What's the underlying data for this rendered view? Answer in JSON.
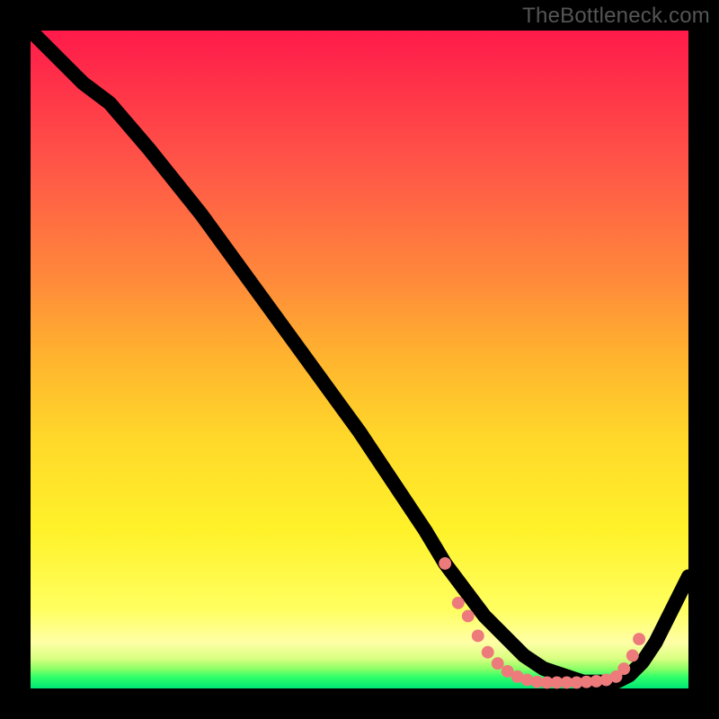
{
  "watermark": "TheBottleneck.com",
  "colors": {
    "curve": "#000000",
    "marker": "#ee7b7b",
    "frame": "#000000"
  },
  "chart_data": {
    "type": "line",
    "title": "",
    "xlabel": "",
    "ylabel": "",
    "xlim": [
      0,
      100
    ],
    "ylim": [
      0,
      100
    ],
    "grid": false,
    "legend": false,
    "series": [
      {
        "name": "bottleneck-curve",
        "x": [
          0,
          4,
          8,
          12,
          18,
          26,
          34,
          42,
          50,
          56,
          60,
          63,
          66,
          69,
          72,
          75,
          78,
          81,
          84,
          87,
          89,
          91,
          93,
          95,
          97,
          100
        ],
        "y": [
          100,
          96,
          92,
          89,
          82,
          72,
          61,
          50,
          39,
          30,
          24,
          19,
          15,
          11,
          8,
          5,
          3,
          2,
          1,
          1,
          1,
          2,
          4,
          7,
          11,
          17
        ]
      }
    ],
    "markers": [
      {
        "x": 63.0,
        "y": 19.0
      },
      {
        "x": 65.0,
        "y": 13.0
      },
      {
        "x": 66.5,
        "y": 11.0
      },
      {
        "x": 68.0,
        "y": 8.0
      },
      {
        "x": 69.5,
        "y": 5.5
      },
      {
        "x": 71.0,
        "y": 3.8
      },
      {
        "x": 72.5,
        "y": 2.6
      },
      {
        "x": 74.0,
        "y": 1.8
      },
      {
        "x": 75.5,
        "y": 1.3
      },
      {
        "x": 77.0,
        "y": 1.0
      },
      {
        "x": 78.5,
        "y": 0.9
      },
      {
        "x": 80.0,
        "y": 0.9
      },
      {
        "x": 81.5,
        "y": 0.9
      },
      {
        "x": 83.0,
        "y": 0.9
      },
      {
        "x": 84.5,
        "y": 1.0
      },
      {
        "x": 86.0,
        "y": 1.1
      },
      {
        "x": 87.5,
        "y": 1.3
      },
      {
        "x": 89.0,
        "y": 1.8
      },
      {
        "x": 90.2,
        "y": 3.0
      },
      {
        "x": 91.5,
        "y": 5.0
      },
      {
        "x": 92.5,
        "y": 7.5
      }
    ],
    "background_gradient": {
      "top": "#ff1a4a",
      "mid": "#fff22a",
      "bottom": "#00e676"
    }
  }
}
